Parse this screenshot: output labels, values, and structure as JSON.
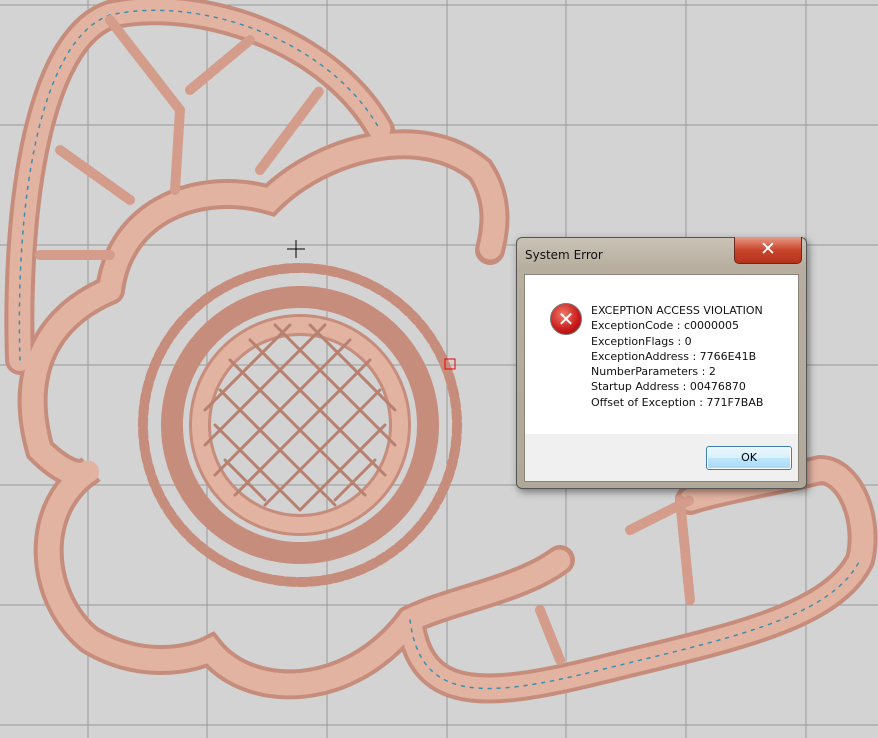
{
  "dialog": {
    "title": "System Error",
    "close_label": "✕",
    "icon": "error-icon",
    "lines": [
      "EXCEPTION ACCESS VIOLATION",
      "ExceptionCode : c0000005",
      "ExceptionFlags : 0",
      "ExceptionAddress : 7766E41B",
      "NumberParameters : 2",
      "Startup Address : 00476870",
      "Offset of Exception : 771F7BAB"
    ],
    "ok_label": "OK"
  },
  "colors": {
    "thread": "#d9a592",
    "thread_dark": "#a86a5a",
    "accent_thread": "#3a8fb0",
    "background": "#d3d3d3",
    "grid": "#9a9a9a"
  }
}
